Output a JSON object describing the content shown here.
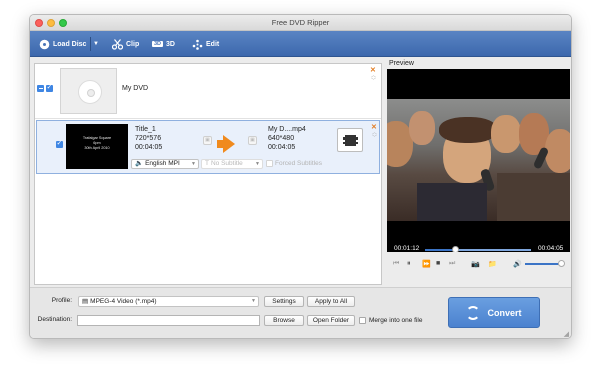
{
  "window": {
    "title": "Free DVD Ripper"
  },
  "toolbar": {
    "load_disc": "Load Disc",
    "clip": "Clip",
    "threed": "3D",
    "edit": "Edit",
    "threed_badge": "3D"
  },
  "list": {
    "dvd": {
      "name": "My DVD"
    },
    "title": {
      "thumb_lines": [
        "Trafalgar Square",
        "6pm",
        "30th April 2010"
      ],
      "source_name": "Title_1",
      "source_resolution": "720*576",
      "source_duration": "00:04:05",
      "target_name": "My D....mp4",
      "target_resolution": "640*480",
      "target_duration": "00:04:05",
      "audio_track": "English MPI",
      "subtitle": "No Subtitle",
      "forced_subtitles": "Forced Subtitles"
    }
  },
  "preview": {
    "label": "Preview",
    "current_time": "00:01:12",
    "total_time": "00:04:05",
    "progress": 0.29,
    "volume": 1.0
  },
  "bottom": {
    "profile_label": "Profile:",
    "profile_value": "MPEG-4 Video (*.mp4)",
    "settings": "Settings",
    "apply_all": "Apply to All",
    "destination_label": "Destination:",
    "destination_value": "",
    "browse": "Browse",
    "open_folder": "Open Folder",
    "merge_label": "Merge into one file",
    "convert": "Convert"
  },
  "colors": {
    "toolbar": "#4a75b8",
    "accent_blue": "#3f86e3",
    "arrow_orange": "#f08a1d",
    "convert_button": "#5a8fd8"
  }
}
